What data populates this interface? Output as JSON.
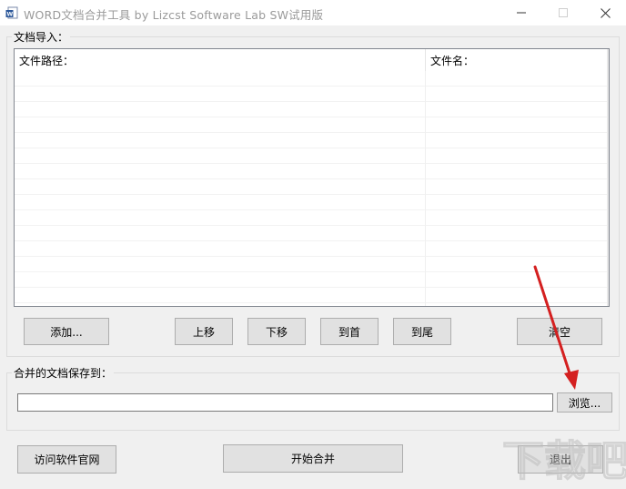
{
  "window": {
    "title": "WORD文档合并工具   by Lizcst Software Lab   SW试用版",
    "minimize_glyph": "—",
    "maximize_glyph": "☐",
    "close_glyph": "✕"
  },
  "import_group": {
    "label": "文档导入：",
    "columns": [
      "文件路径：",
      "文件名："
    ],
    "rows": []
  },
  "buttons": {
    "add": "添加...",
    "move_up": "上移",
    "move_down": "下移",
    "to_top": "到首",
    "to_bottom": "到尾",
    "clear": "清空",
    "browse": "浏览...",
    "visit_site": "访问软件官网",
    "start_merge": "开始合并",
    "exit": "退出"
  },
  "save_group": {
    "label": "合并的文档保存到：",
    "path_value": "",
    "path_placeholder": ""
  },
  "annotation": {
    "arrow_color": "#d42020",
    "target": "browse-button"
  },
  "watermark": {
    "text": "下载吧"
  },
  "colors": {
    "window_bg": "#f0f0f0",
    "button_bg": "#e1e1e1",
    "button_border": "#adadad",
    "title_text": "#9a9a9a"
  }
}
